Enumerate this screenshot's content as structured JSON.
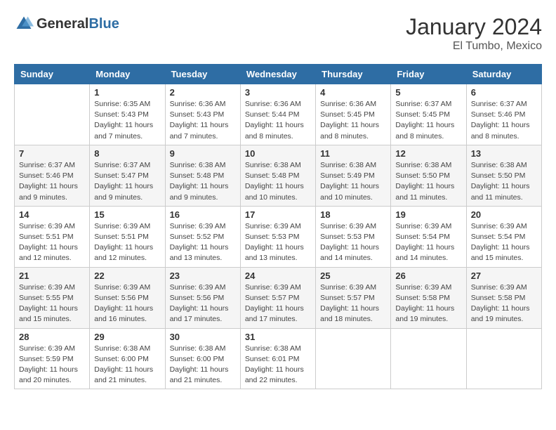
{
  "logo": {
    "general": "General",
    "blue": "Blue"
  },
  "header": {
    "month": "January 2024",
    "location": "El Tumbo, Mexico"
  },
  "calendar": {
    "weekdays": [
      "Sunday",
      "Monday",
      "Tuesday",
      "Wednesday",
      "Thursday",
      "Friday",
      "Saturday"
    ],
    "rows": [
      [
        {
          "day": "",
          "info": ""
        },
        {
          "day": "1",
          "info": "Sunrise: 6:35 AM\nSunset: 5:43 PM\nDaylight: 11 hours\nand 7 minutes."
        },
        {
          "day": "2",
          "info": "Sunrise: 6:36 AM\nSunset: 5:43 PM\nDaylight: 11 hours\nand 7 minutes."
        },
        {
          "day": "3",
          "info": "Sunrise: 6:36 AM\nSunset: 5:44 PM\nDaylight: 11 hours\nand 8 minutes."
        },
        {
          "day": "4",
          "info": "Sunrise: 6:36 AM\nSunset: 5:45 PM\nDaylight: 11 hours\nand 8 minutes."
        },
        {
          "day": "5",
          "info": "Sunrise: 6:37 AM\nSunset: 5:45 PM\nDaylight: 11 hours\nand 8 minutes."
        },
        {
          "day": "6",
          "info": "Sunrise: 6:37 AM\nSunset: 5:46 PM\nDaylight: 11 hours\nand 8 minutes."
        }
      ],
      [
        {
          "day": "7",
          "info": "Sunrise: 6:37 AM\nSunset: 5:46 PM\nDaylight: 11 hours\nand 9 minutes."
        },
        {
          "day": "8",
          "info": "Sunrise: 6:37 AM\nSunset: 5:47 PM\nDaylight: 11 hours\nand 9 minutes."
        },
        {
          "day": "9",
          "info": "Sunrise: 6:38 AM\nSunset: 5:48 PM\nDaylight: 11 hours\nand 9 minutes."
        },
        {
          "day": "10",
          "info": "Sunrise: 6:38 AM\nSunset: 5:48 PM\nDaylight: 11 hours\nand 10 minutes."
        },
        {
          "day": "11",
          "info": "Sunrise: 6:38 AM\nSunset: 5:49 PM\nDaylight: 11 hours\nand 10 minutes."
        },
        {
          "day": "12",
          "info": "Sunrise: 6:38 AM\nSunset: 5:50 PM\nDaylight: 11 hours\nand 11 minutes."
        },
        {
          "day": "13",
          "info": "Sunrise: 6:38 AM\nSunset: 5:50 PM\nDaylight: 11 hours\nand 11 minutes."
        }
      ],
      [
        {
          "day": "14",
          "info": "Sunrise: 6:39 AM\nSunset: 5:51 PM\nDaylight: 11 hours\nand 12 minutes."
        },
        {
          "day": "15",
          "info": "Sunrise: 6:39 AM\nSunset: 5:51 PM\nDaylight: 11 hours\nand 12 minutes."
        },
        {
          "day": "16",
          "info": "Sunrise: 6:39 AM\nSunset: 5:52 PM\nDaylight: 11 hours\nand 13 minutes."
        },
        {
          "day": "17",
          "info": "Sunrise: 6:39 AM\nSunset: 5:53 PM\nDaylight: 11 hours\nand 13 minutes."
        },
        {
          "day": "18",
          "info": "Sunrise: 6:39 AM\nSunset: 5:53 PM\nDaylight: 11 hours\nand 14 minutes."
        },
        {
          "day": "19",
          "info": "Sunrise: 6:39 AM\nSunset: 5:54 PM\nDaylight: 11 hours\nand 14 minutes."
        },
        {
          "day": "20",
          "info": "Sunrise: 6:39 AM\nSunset: 5:54 PM\nDaylight: 11 hours\nand 15 minutes."
        }
      ],
      [
        {
          "day": "21",
          "info": "Sunrise: 6:39 AM\nSunset: 5:55 PM\nDaylight: 11 hours\nand 15 minutes."
        },
        {
          "day": "22",
          "info": "Sunrise: 6:39 AM\nSunset: 5:56 PM\nDaylight: 11 hours\nand 16 minutes."
        },
        {
          "day": "23",
          "info": "Sunrise: 6:39 AM\nSunset: 5:56 PM\nDaylight: 11 hours\nand 17 minutes."
        },
        {
          "day": "24",
          "info": "Sunrise: 6:39 AM\nSunset: 5:57 PM\nDaylight: 11 hours\nand 17 minutes."
        },
        {
          "day": "25",
          "info": "Sunrise: 6:39 AM\nSunset: 5:57 PM\nDaylight: 11 hours\nand 18 minutes."
        },
        {
          "day": "26",
          "info": "Sunrise: 6:39 AM\nSunset: 5:58 PM\nDaylight: 11 hours\nand 19 minutes."
        },
        {
          "day": "27",
          "info": "Sunrise: 6:39 AM\nSunset: 5:58 PM\nDaylight: 11 hours\nand 19 minutes."
        }
      ],
      [
        {
          "day": "28",
          "info": "Sunrise: 6:39 AM\nSunset: 5:59 PM\nDaylight: 11 hours\nand 20 minutes."
        },
        {
          "day": "29",
          "info": "Sunrise: 6:38 AM\nSunset: 6:00 PM\nDaylight: 11 hours\nand 21 minutes."
        },
        {
          "day": "30",
          "info": "Sunrise: 6:38 AM\nSunset: 6:00 PM\nDaylight: 11 hours\nand 21 minutes."
        },
        {
          "day": "31",
          "info": "Sunrise: 6:38 AM\nSunset: 6:01 PM\nDaylight: 11 hours\nand 22 minutes."
        },
        {
          "day": "",
          "info": ""
        },
        {
          "day": "",
          "info": ""
        },
        {
          "day": "",
          "info": ""
        }
      ]
    ]
  }
}
